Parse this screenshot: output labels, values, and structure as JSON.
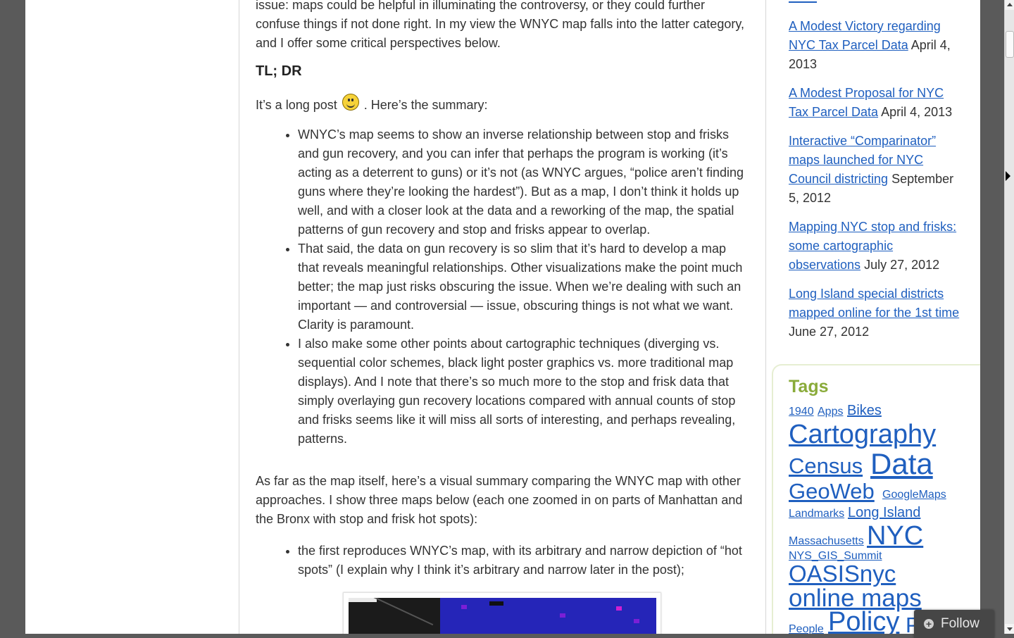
{
  "article": {
    "intro_partial": "issue: maps could be helpful in illuminating the controversy, or they could further confuse things if not done right. In my view the WNYC map falls into the latter category, and I offer some critical perspectives below.",
    "tldr_heading": "TL; DR",
    "long_post_before": "It’s a long post",
    "long_post_after": ". Here’s the summary:",
    "summary_bullets": [
      "WNYC’s map seems to show an inverse relationship between stop and frisks and gun recovery, and you can infer that perhaps the program is working (it’s acting as a deterrent to guns) or it’s not (as WNYC argues, “police aren’t finding guns where they’re looking the hardest”). But as a map, I don’t think it holds up well, and with a closer look at the data and a reworking of the map, the spatial patterns of gun recovery and stop and frisks appear to overlap.",
      "That said, the data on gun recovery is so slim that it’s hard to develop a map that reveals meaningful relationships. Other visualizations make the point much better; the map just risks obscuring the issue. When we’re dealing with such an important — and controversial — issue, obscuring things is not what we want. Clarity is paramount.",
      "I also make some other points about cartographic techniques (diverging vs. sequential color schemes, black light poster graphics vs. more traditional map displays). And I note that there’s so much more to the stop and frisk data that simply overlaying gun recovery locations compared with annual counts of stop and frisks seems like it will miss all sorts of interesting, and perhaps revealing, patterns."
    ],
    "map_paragraph": "As far as the map itself, here’s a visual summary comparing the WNYC map with other approaches.  I show three maps below (each one zoomed in on parts of Manhattan and the Bronx with stop and frisk hot spots):",
    "map_bullets": [
      "the first reproduces WNYC’s map, with its arbitrary and narrow depiction of “hot spots” (I explain why I think it’s arbitrary and narrow later in the post);"
    ]
  },
  "sidebar": {
    "recent_posts": [
      {
        "title": "A Modest Victory regarding NYC Tax Parcel Data",
        "date": "April 4, 2013"
      },
      {
        "title": "A Modest Proposal for NYC Tax Parcel Data",
        "date": "April 4, 2013"
      },
      {
        "title": "Interactive “Comparinator” maps launched for NYC Council districting",
        "date": "September 5, 2012"
      },
      {
        "title": "Mapping NYC stop and frisks: some cartographic observations",
        "date": "July 27, 2012"
      },
      {
        "title": "Long Island special districts mapped online for the 1st time",
        "date": "June 27, 2012"
      }
    ],
    "tags_title": "Tags",
    "tags": [
      "1940",
      "Apps",
      "Bikes",
      "Cartography",
      "Census",
      "Data",
      "GeoWeb",
      "GoogleMaps",
      "Landmarks",
      "Long Island",
      "Massachusetts",
      "NYC",
      "NYS_GIS_Summit",
      "OASISnyc",
      "online maps",
      "People",
      "Policy",
      "P"
    ]
  },
  "follow_button": {
    "label": "Follow",
    "icon": "plus-circle-icon"
  },
  "colors": {
    "link": "#1f5fbf",
    "tags_heading": "#8aab3a",
    "follow_bg": "#464646"
  }
}
